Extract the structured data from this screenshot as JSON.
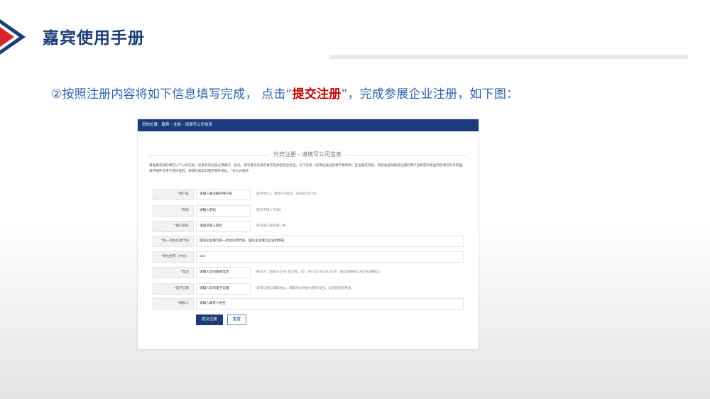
{
  "slide": {
    "title": "嘉宾使用手册",
    "instruction": {
      "before": "②按照注册内容将如下信息填写完成， 点击“",
      "highlight": "提交注册",
      "after": "”，完成参展企业注册，如下图："
    }
  },
  "screenshot": {
    "breadcrumb": "您的位置：嘉宾 - 注册 - 请填写公司信息",
    "form_title": "外宾注册 - 请填写公司信息",
    "intro": "请准确无误的填写以下公司信息，您发布的信息必须真实、合法，发布者对信息的真实性承担完全责任。以下信息一经审核通过后将不能修改，且注册成功后，系统会自动将您注册的用户名和密码发送到您填写的手机里。电子邮件可用于密码找回，请填写真实的电子邮件地址。*号为必填项",
    "fields": [
      {
        "label": "*用户名",
        "placeholder": "请输入要注册的用户名",
        "hint": "由字母a-z、数字0-9组成，且长度为4-30"
      },
      {
        "label": "*密码",
        "placeholder": "请输入密码",
        "hint": "密码不得少于6位"
      },
      {
        "label": "*确认密码",
        "placeholder": "请再次输入密码",
        "hint": "两次输入密码需一致"
      },
      {
        "label": "*统一社会信用代码",
        "placeholder": "国内企业填写统一社会信用代码，国外企业填写企业机构码",
        "hint": ""
      },
      {
        "label": "*单位名称（中文）",
        "placeholder": "asd",
        "hint": ""
      },
      {
        "label": "*电话",
        "placeholder": "请输入您的联系电话",
        "hint": "格式为：国家号-区号-电话号，如：86-451-82340100（输出前确保公司为长期确认）"
      },
      {
        "label": "*电子信箱",
        "placeholder": "请输入您的电子信箱",
        "hint": "请填写真实邮箱地址，邮箱地址将做为密码找回，信息联络等用途。"
      },
      {
        "label": "*联系人",
        "placeholder": "请输入联系人姓名",
        "hint": ""
      }
    ],
    "buttons": {
      "submit": "提交注册",
      "reset": "重置"
    }
  },
  "colors": {
    "title": "#1d3d78",
    "instruction": "#2e62ad",
    "highlight": "#c00000",
    "header_bar": "#1c3a7c"
  }
}
